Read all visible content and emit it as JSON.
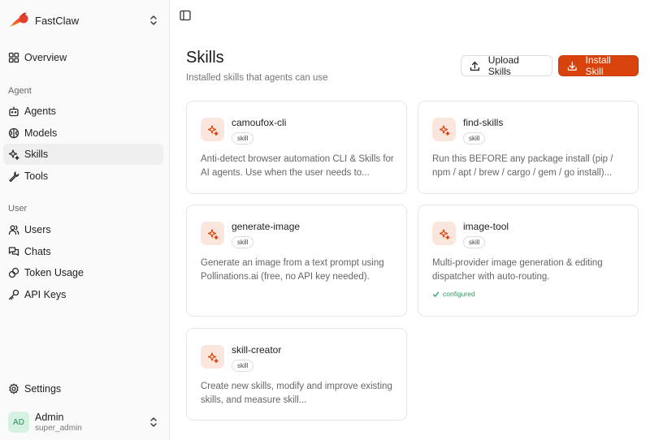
{
  "app": {
    "name": "FastClaw"
  },
  "sidebar": {
    "overview": "Overview",
    "section_agent": "Agent",
    "agents": "Agents",
    "models": "Models",
    "skills": "Skills",
    "tools": "Tools",
    "section_user": "User",
    "users": "Users",
    "chats": "Chats",
    "token_usage": "Token Usage",
    "api_keys": "API Keys",
    "settings": "Settings"
  },
  "user": {
    "initials": "AD",
    "name": "Admin",
    "role": "super_admin"
  },
  "page": {
    "title": "Skills",
    "subtitle": "Installed skills that agents can use"
  },
  "actions": {
    "upload": "Upload Skills",
    "install": "Install Skill"
  },
  "colors": {
    "accent": "#d8420b",
    "accent_soft": "#fbe6dd",
    "configured": "#2f9a5f"
  },
  "skills": [
    {
      "name": "camoufox-cli",
      "badge": "skill",
      "description": "Anti-detect browser automation CLI & Skills for AI agents. Use when the user needs to..."
    },
    {
      "name": "find-skills",
      "badge": "skill",
      "description": "Run this BEFORE any package install (pip / npm / apt / brew / cargo / gem / go install)..."
    },
    {
      "name": "generate-image",
      "badge": "skill",
      "description": "Generate an image from a text prompt using Pollinations.ai (free, no API key needed)."
    },
    {
      "name": "image-tool",
      "badge": "skill",
      "description": "Multi-provider image generation & editing dispatcher with auto-routing.",
      "status": "configured"
    },
    {
      "name": "skill-creator",
      "badge": "skill",
      "description": "Create new skills, modify and improve existing skills, and measure skill..."
    }
  ]
}
